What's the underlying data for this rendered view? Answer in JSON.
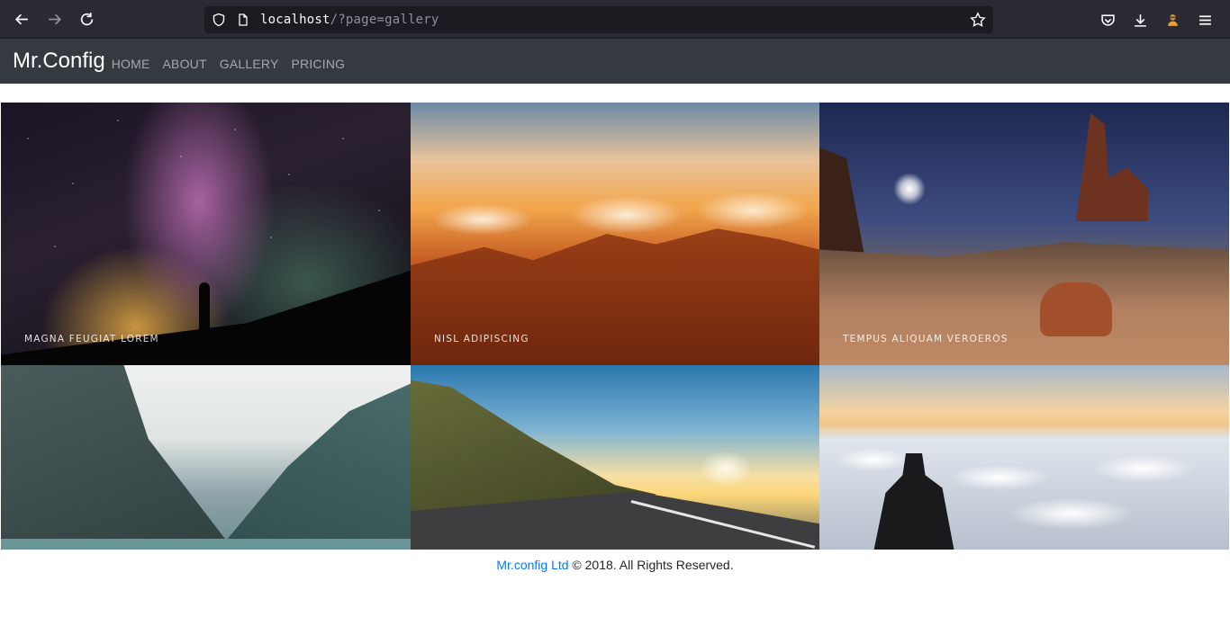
{
  "browser": {
    "url_host": "localhost",
    "url_path": "/?page=gallery",
    "icons": [
      "back-icon",
      "forward-icon",
      "reload-icon",
      "shield-icon",
      "page-icon",
      "bookmark-star-icon",
      "pocket-icon",
      "download-icon",
      "extension-icon",
      "menu-icon"
    ]
  },
  "nav": {
    "brand": "Mr.Config",
    "items": [
      {
        "label": "HOME"
      },
      {
        "label": "ABOUT"
      },
      {
        "label": "GALLERY"
      },
      {
        "label": "PRICING"
      }
    ]
  },
  "gallery": {
    "tiles": [
      {
        "caption": "MAGNA FEUGIAT LOREM"
      },
      {
        "caption": "NISL ADIPISCING"
      },
      {
        "caption": "TEMPUS ALIQUAM VEROEROS"
      },
      {
        "caption": ""
      },
      {
        "caption": ""
      },
      {
        "caption": ""
      }
    ]
  },
  "footer": {
    "link": "Mr.config Ltd",
    "text": " © 2018. All Rights Reserved."
  },
  "colors": {
    "navbar_bg": "#343a40",
    "link": "#007bff",
    "browser_bg": "#2b2a33"
  }
}
